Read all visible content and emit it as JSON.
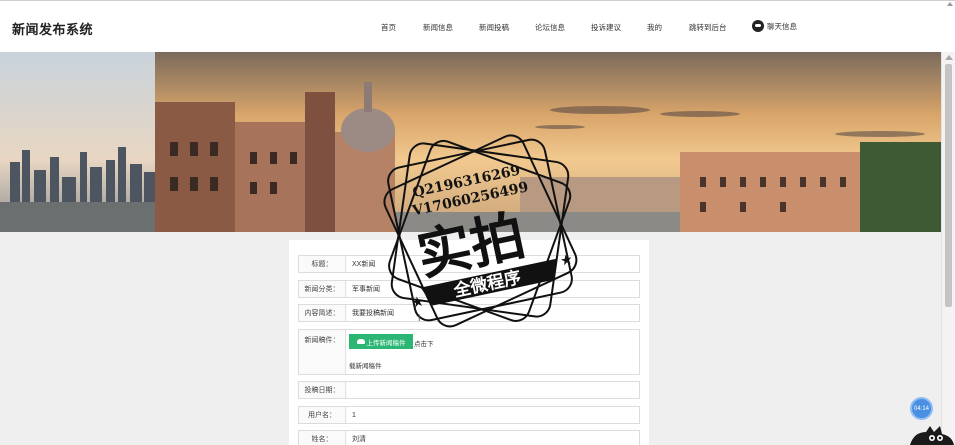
{
  "header": {
    "brand": "新闻发布系统",
    "nav": [
      "首页",
      "新闻信息",
      "新闻投稿",
      "论坛信息",
      "投诉建议",
      "我的",
      "跳转到后台"
    ],
    "chat_label": "聊天信息",
    "chat_icon": "chat-bubble-icon"
  },
  "form": {
    "title_label": "标题：",
    "title_value": "XX新闻",
    "category_label": "新闻分类：",
    "category_value": "军事新闻",
    "desc_label": "内容简述：",
    "desc_value": "我要投稿新闻",
    "attach_label": "新闻稿件：",
    "upload_button": "上传新闻稿件",
    "upload_hint": "点击下",
    "attach_file": "载新闻稿件",
    "date_label": "投稿日期：",
    "date_value": "",
    "user_label": "用户名：",
    "user_value": "1",
    "name_label": "姓名：",
    "name_value": "刘清"
  },
  "watermark": {
    "line1": "Q2196316269",
    "line2": "V17060256499",
    "main": "实拍",
    "ribbon": "全微程序"
  },
  "widgets": {
    "timer": "04:14"
  },
  "colors": {
    "upload_green": "#2bb673",
    "timer_blue": "#4a90e2"
  }
}
